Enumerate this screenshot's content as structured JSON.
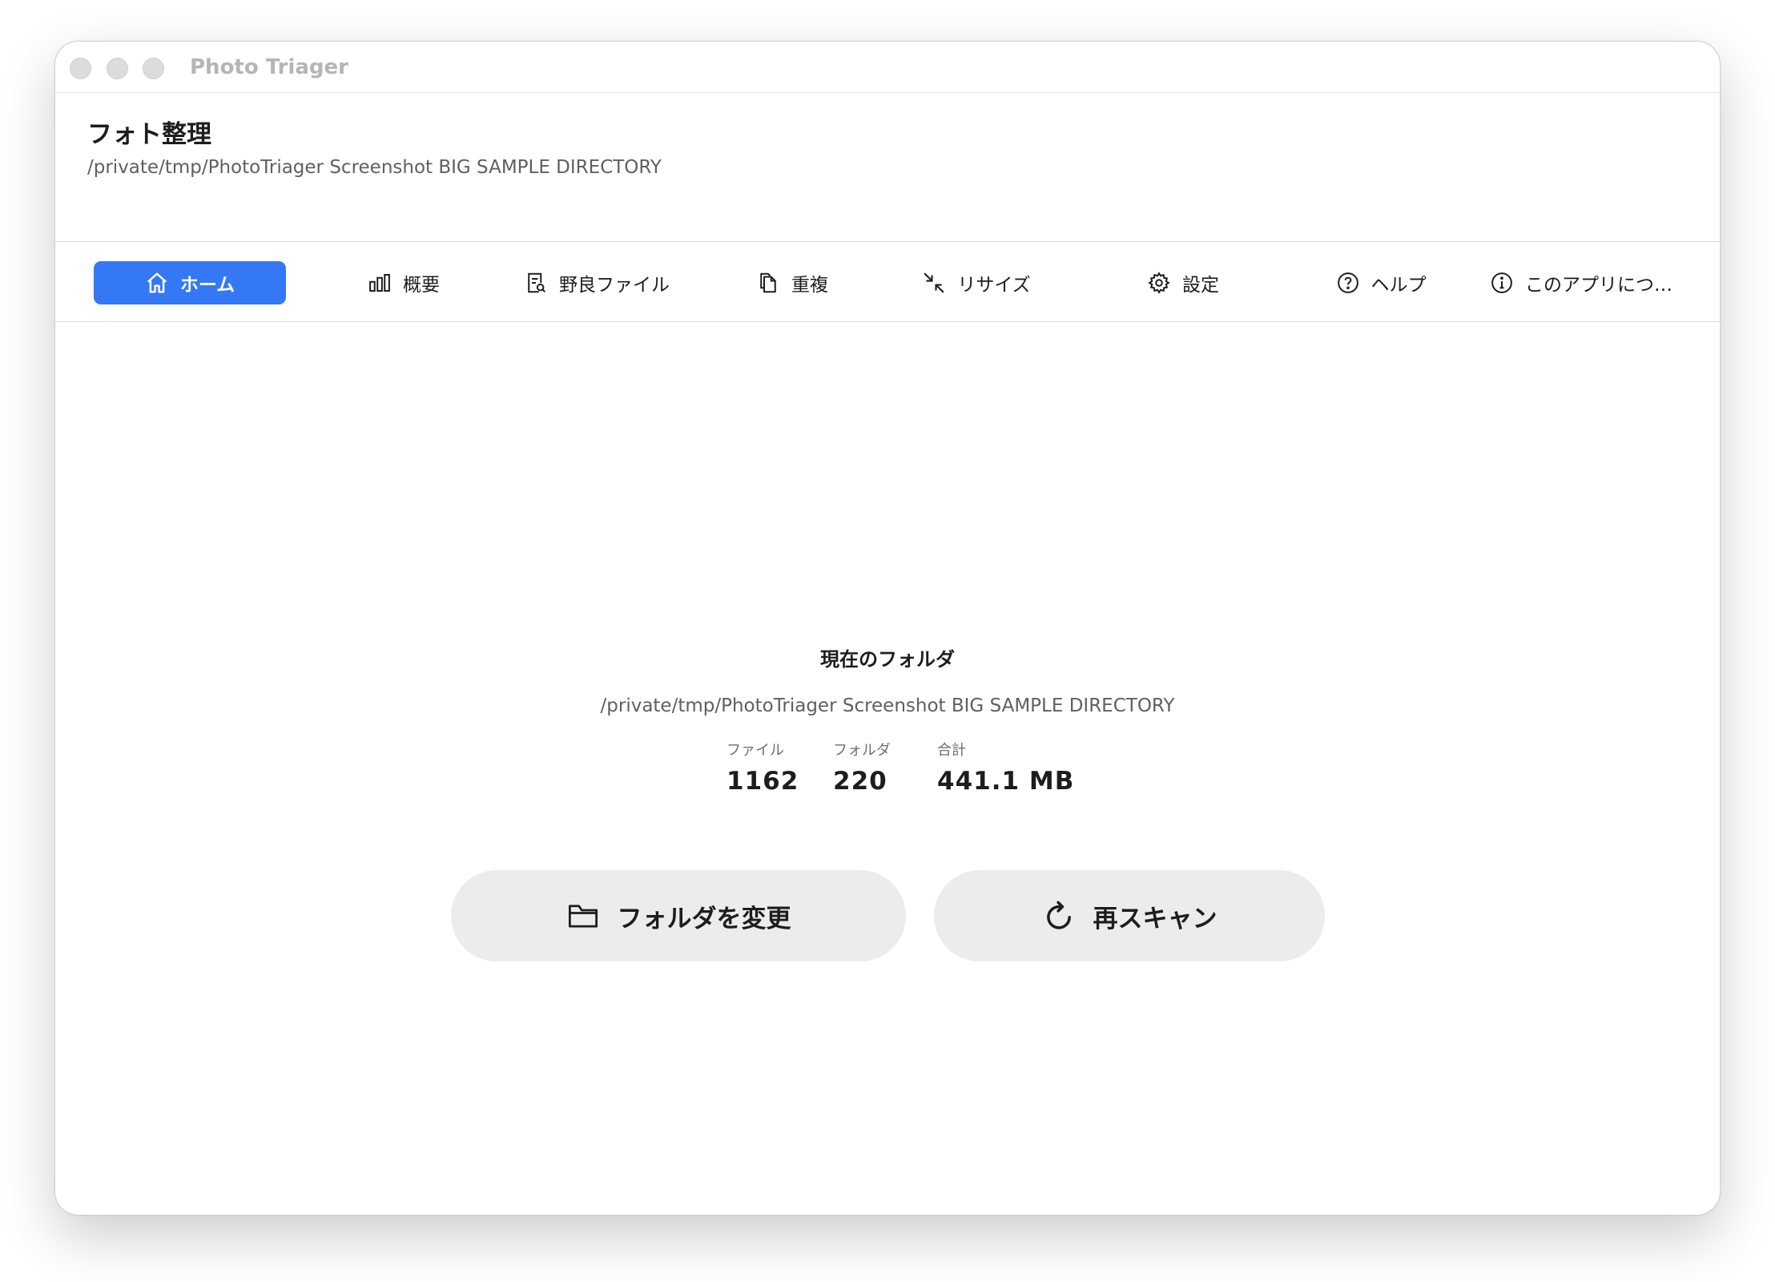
{
  "window": {
    "title": "Photo Triager"
  },
  "header": {
    "title": "フォト整理",
    "path": "/private/tmp/PhotoTriager Screenshot BIG SAMPLE DIRECTORY"
  },
  "tabs": [
    {
      "label": "ホーム",
      "icon": "home-icon",
      "active": true
    },
    {
      "label": "概要",
      "icon": "bar-chart-icon",
      "active": false
    },
    {
      "label": "野良ファイル",
      "icon": "doc-search-icon",
      "active": false
    },
    {
      "label": "重複",
      "icon": "duplicate-icon",
      "active": false
    },
    {
      "label": "リサイズ",
      "icon": "shrink-arrows-icon",
      "active": false
    },
    {
      "label": "設定",
      "icon": "gear-icon",
      "active": false
    },
    {
      "label": "ヘルプ",
      "icon": "question-icon",
      "active": false
    },
    {
      "label": "このアプリにつ…",
      "icon": "info-icon",
      "active": false
    }
  ],
  "main": {
    "section_title": "現在のフォルダ",
    "folder_path": "/private/tmp/PhotoTriager Screenshot BIG SAMPLE DIRECTORY",
    "stats": [
      {
        "label": "ファイル",
        "value": "1162"
      },
      {
        "label": "フォルダ",
        "value": "220"
      },
      {
        "label": "合計",
        "value": "441.1 MB"
      }
    ],
    "change_folder_label": "フォルダを変更",
    "rescan_label": "再スキャン"
  },
  "colors": {
    "accent": "#3478f6",
    "button_bg": "#ececec"
  }
}
